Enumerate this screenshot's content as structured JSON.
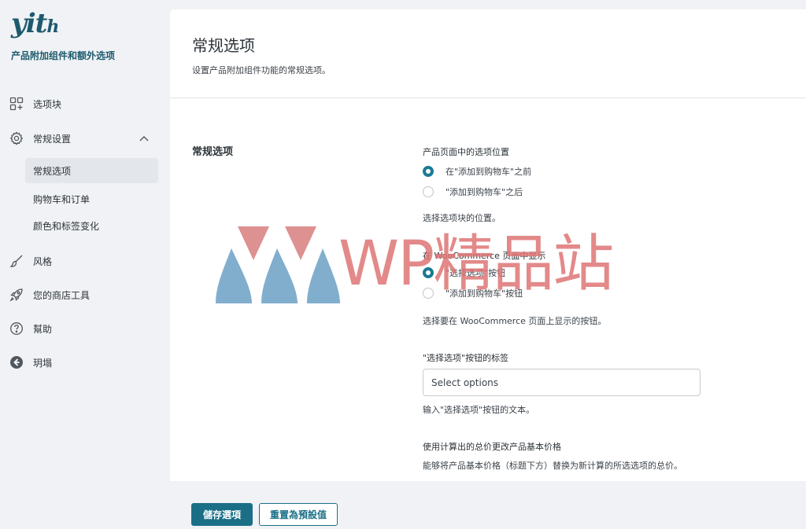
{
  "brand": {
    "logo": "yith",
    "subtitle": "产品附加组件和额外选项"
  },
  "sidebar": {
    "items": [
      {
        "label": "选项块",
        "icon": "blocks-icon"
      },
      {
        "label": "常规设置",
        "icon": "gear-icon",
        "expanded": true
      },
      {
        "label": "风格",
        "icon": "brush-icon"
      },
      {
        "label": "您的商店工具",
        "icon": "rocket-icon"
      },
      {
        "label": "幫助",
        "icon": "help-icon"
      },
      {
        "label": "玥塌",
        "icon": "arrow-left-circle-icon"
      }
    ],
    "subitems": [
      {
        "label": "常规选项",
        "active": true
      },
      {
        "label": "购物车和订单",
        "active": false
      },
      {
        "label": "颜色和标签变化",
        "active": false
      }
    ]
  },
  "header": {
    "title": "常规选项",
    "description": "设置产品附加组件功能的常规选项。"
  },
  "section": {
    "title": "常规选项"
  },
  "options": {
    "position": {
      "label": "产品页面中的选项位置",
      "choices": [
        "在\"添加到购物车\"之前",
        "\"添加到购物车\"之后"
      ],
      "selected": 0,
      "description": "选择选项块的位置。"
    },
    "shop_button": {
      "label": "在 WooCommerce 页面中显示",
      "choices": [
        "\"选择选项\"按钮",
        "\"添加到购物车\"按钮"
      ],
      "selected": 0,
      "description": "选择要在 WooCommerce 页面上显示的按钮。"
    },
    "select_label": {
      "label": "\"选择选项\"按钮的标签",
      "value": "Select options",
      "description": "输入\"选择选项\"按钮的文本。"
    },
    "total_price": {
      "label": "使用计算出的总价更改产品基本价格",
      "description": "能够将产品基本价格（标题下方）替换为新计算的所选选项的总价。"
    }
  },
  "footer": {
    "save_label": "儲存選項",
    "reset_label": "重置為預設值"
  },
  "watermark": {
    "text": "WP精品站"
  },
  "colors": {
    "accent": "#1a6f87",
    "brand": "#1d5a6e",
    "watermark_red": "#de7474",
    "watermark_blue": "#6fa4c8"
  }
}
